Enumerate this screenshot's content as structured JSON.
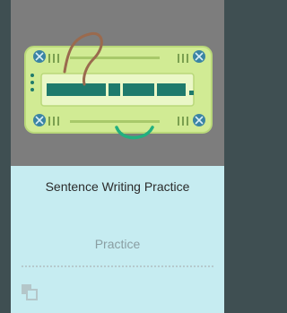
{
  "card": {
    "title": "Sentence Writing Practice",
    "action_label": "Practice",
    "thumbnail_icon": "circuit-sentence-board-illustration",
    "corner_icon": "overlapping-squares-icon"
  },
  "colors": {
    "card_background": "#c6ecf1",
    "thumbnail_background": "#7d7d7d",
    "board_fill": "#d1eb94",
    "sentence_bar": "#1f7a6c",
    "screw": "#3b84a3"
  }
}
